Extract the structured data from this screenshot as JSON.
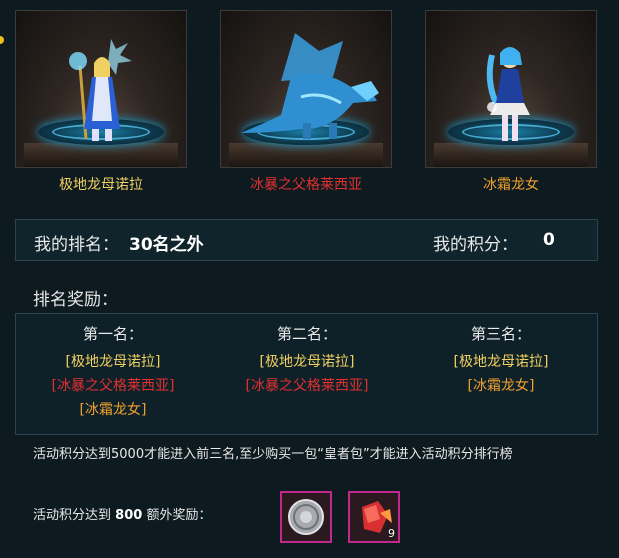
{
  "characters": [
    {
      "name": "极地龙母诺拉",
      "color": "#f0d060"
    },
    {
      "name": "冰暴之父格莱西亚",
      "color": "#e03030"
    },
    {
      "name": "冰霜龙女",
      "color": "#f0a030"
    }
  ],
  "rank_bar": {
    "rank_label": "我的排名：",
    "rank_value": "30名之外",
    "score_label": "我的积分：",
    "score_value": "0"
  },
  "rewards": {
    "title": "排名奖励：",
    "columns": [
      {
        "place": "第一名：",
        "items": [
          "[极地龙母诺拉]",
          "[冰暴之父格莱西亚]",
          "[冰霜龙女]"
        ]
      },
      {
        "place": "第二名：",
        "items": [
          "[极地龙母诺拉]",
          "[冰暴之父格莱西亚]"
        ]
      },
      {
        "place": "第三名：",
        "items": [
          "[极地龙母诺拉]",
          "[冰霜龙女]"
        ]
      }
    ]
  },
  "notice": "活动积分达到5000才能进入前三名,至少购买一包“皇者包”才能进入活动积分排行榜",
  "bonus": {
    "prefix": "活动积分达到",
    "threshold": "800",
    "suffix": "额外奖励：",
    "items": [
      {
        "icon": "silver-coin-icon",
        "count": ""
      },
      {
        "icon": "red-crystal-icon",
        "count": "9"
      }
    ]
  },
  "colors": {
    "yellow": "#f0d060",
    "red": "#e03030",
    "orange": "#f0a030",
    "slot_border": "#c0288c"
  }
}
